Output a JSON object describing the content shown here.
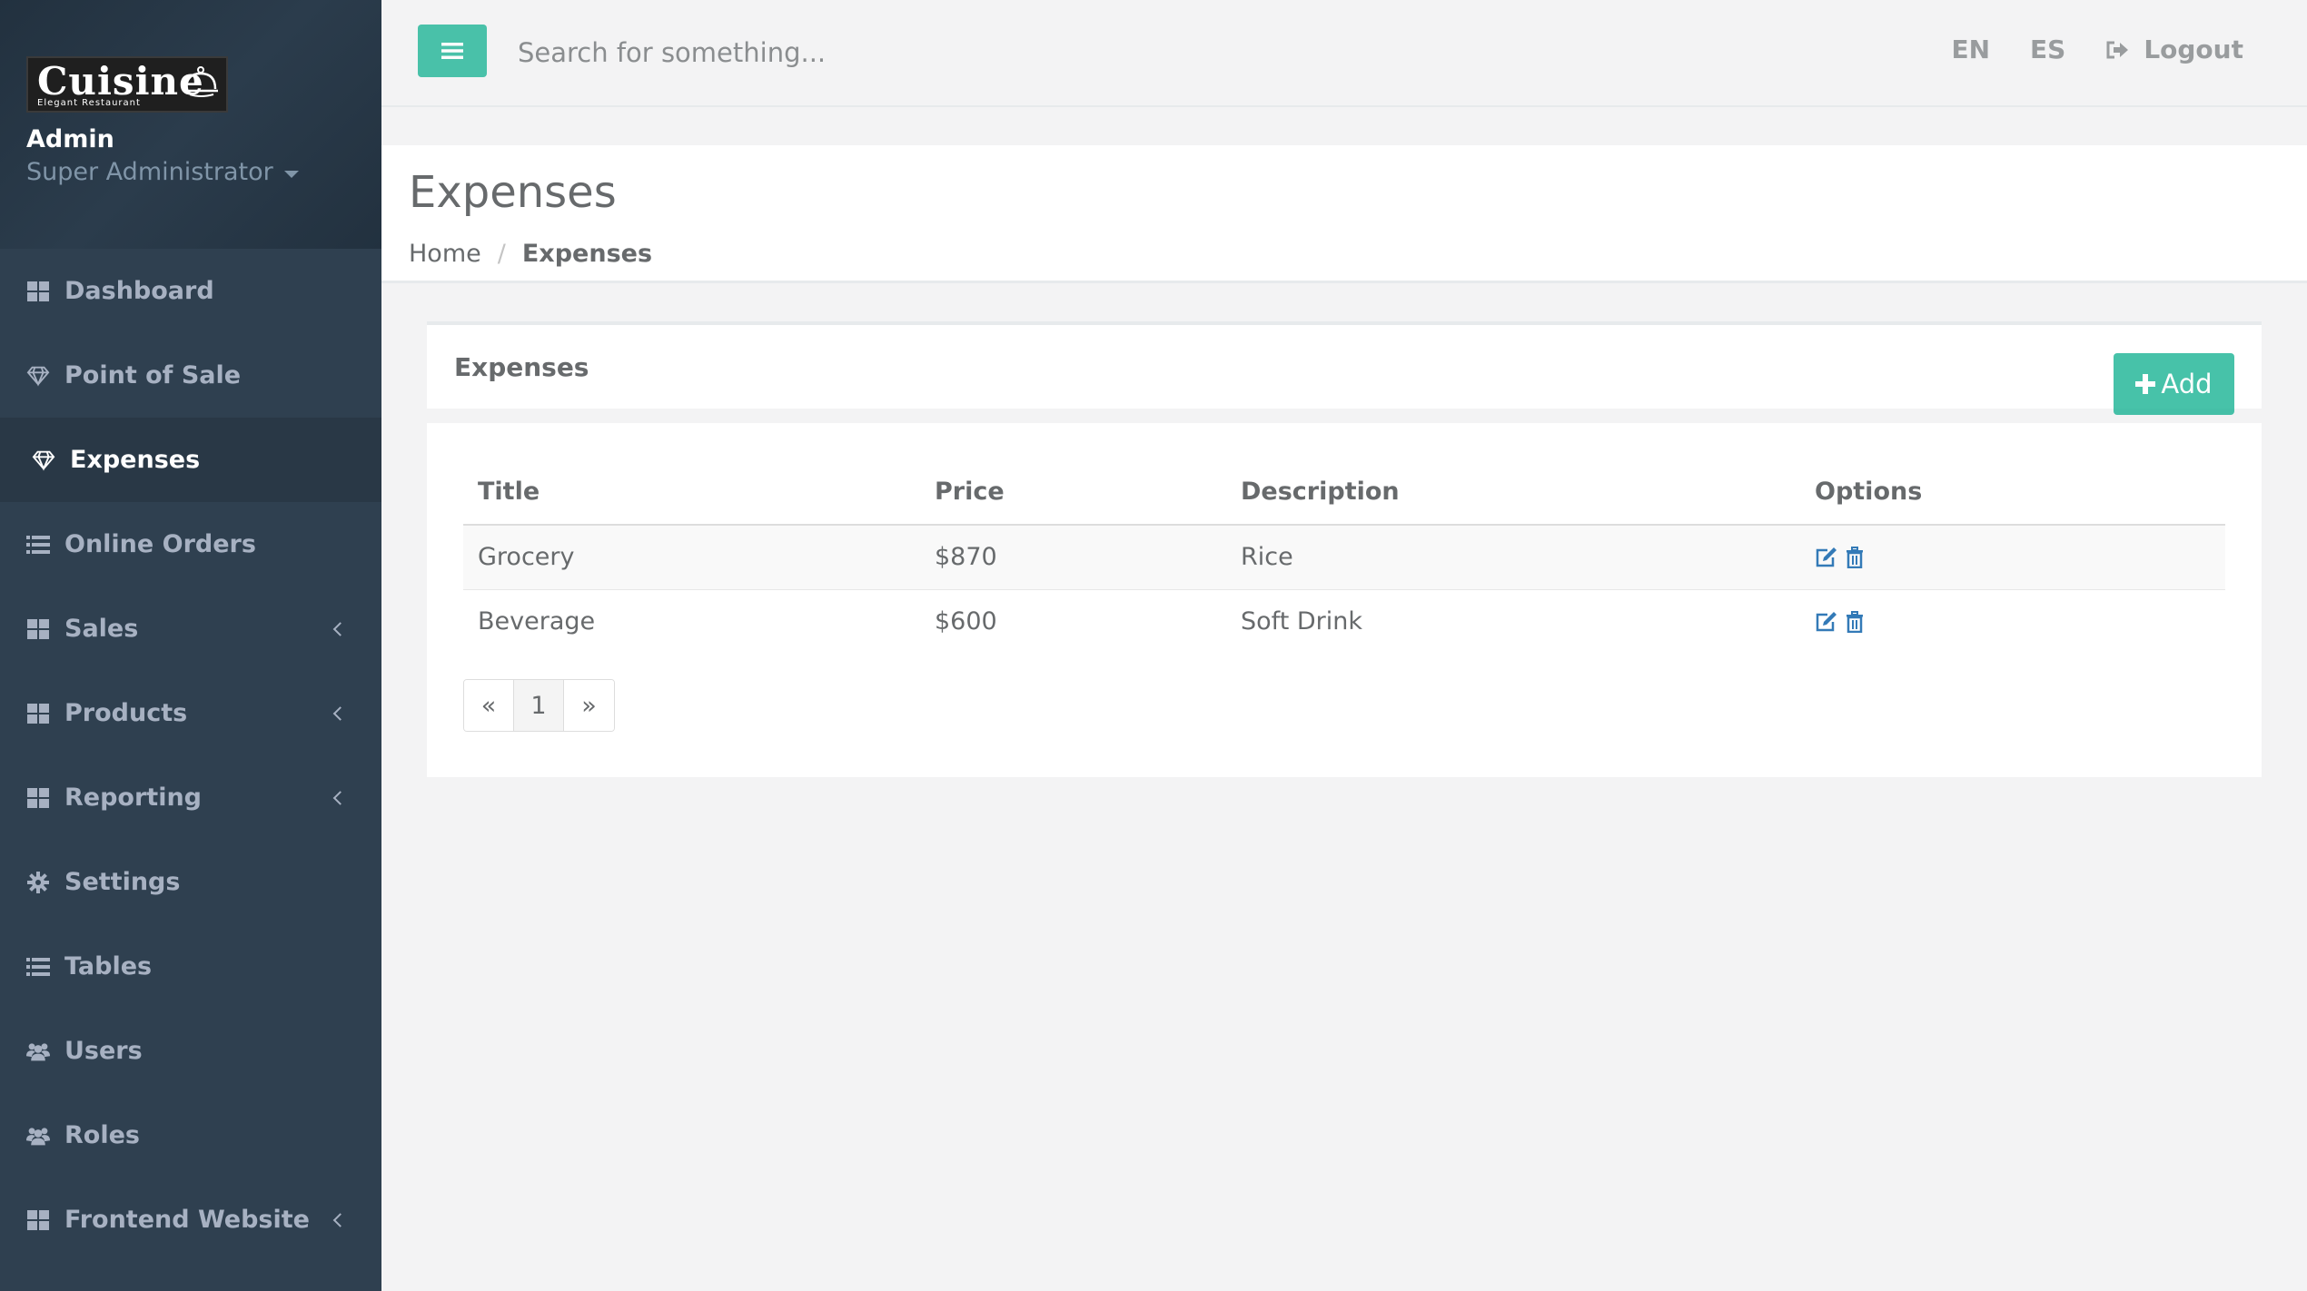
{
  "brand": {
    "logo_text": "Cuisine",
    "logo_sub": "Elegant Restaurant"
  },
  "profile": {
    "name": "Admin",
    "role": "Super Administrator"
  },
  "sidebar": {
    "items": [
      {
        "label": "Dashboard",
        "icon": "th-large-icon"
      },
      {
        "label": "Point of Sale",
        "icon": "diamond-icon"
      },
      {
        "label": "Expenses",
        "icon": "diamond-icon",
        "active": true
      },
      {
        "label": "Online Orders",
        "icon": "list-icon"
      },
      {
        "label": "Sales",
        "icon": "th-large-icon",
        "submenu": true
      },
      {
        "label": "Products",
        "icon": "th-large-icon",
        "submenu": true
      },
      {
        "label": "Reporting",
        "icon": "th-large-icon",
        "submenu": true
      },
      {
        "label": "Settings",
        "icon": "gear-icon"
      },
      {
        "label": "Tables",
        "icon": "list-icon"
      },
      {
        "label": "Users",
        "icon": "users-icon"
      },
      {
        "label": "Roles",
        "icon": "users-icon"
      },
      {
        "label": "Frontend Website",
        "icon": "th-large-icon",
        "submenu": true
      }
    ]
  },
  "topbar": {
    "search_placeholder": "Search for something...",
    "lang_en": "EN",
    "lang_es": "ES",
    "logout": "Logout"
  },
  "page": {
    "title": "Expenses",
    "breadcrumb": {
      "home": "Home",
      "sep": "/",
      "current": "Expenses"
    }
  },
  "panel": {
    "title": "Expenses",
    "add_label": "Add",
    "columns": {
      "title": "Title",
      "price": "Price",
      "description": "Description",
      "options": "Options"
    },
    "rows": [
      {
        "title": "Grocery",
        "price": "$870",
        "description": "Rice"
      },
      {
        "title": "Beverage",
        "price": "$600",
        "description": "Soft Drink"
      }
    ],
    "pagination": {
      "prev": "«",
      "page": "1",
      "next": "»"
    }
  },
  "colors": {
    "sidebar_bg": "#2f4050",
    "accent": "#1ab394",
    "link_icon": "#337ab7"
  }
}
